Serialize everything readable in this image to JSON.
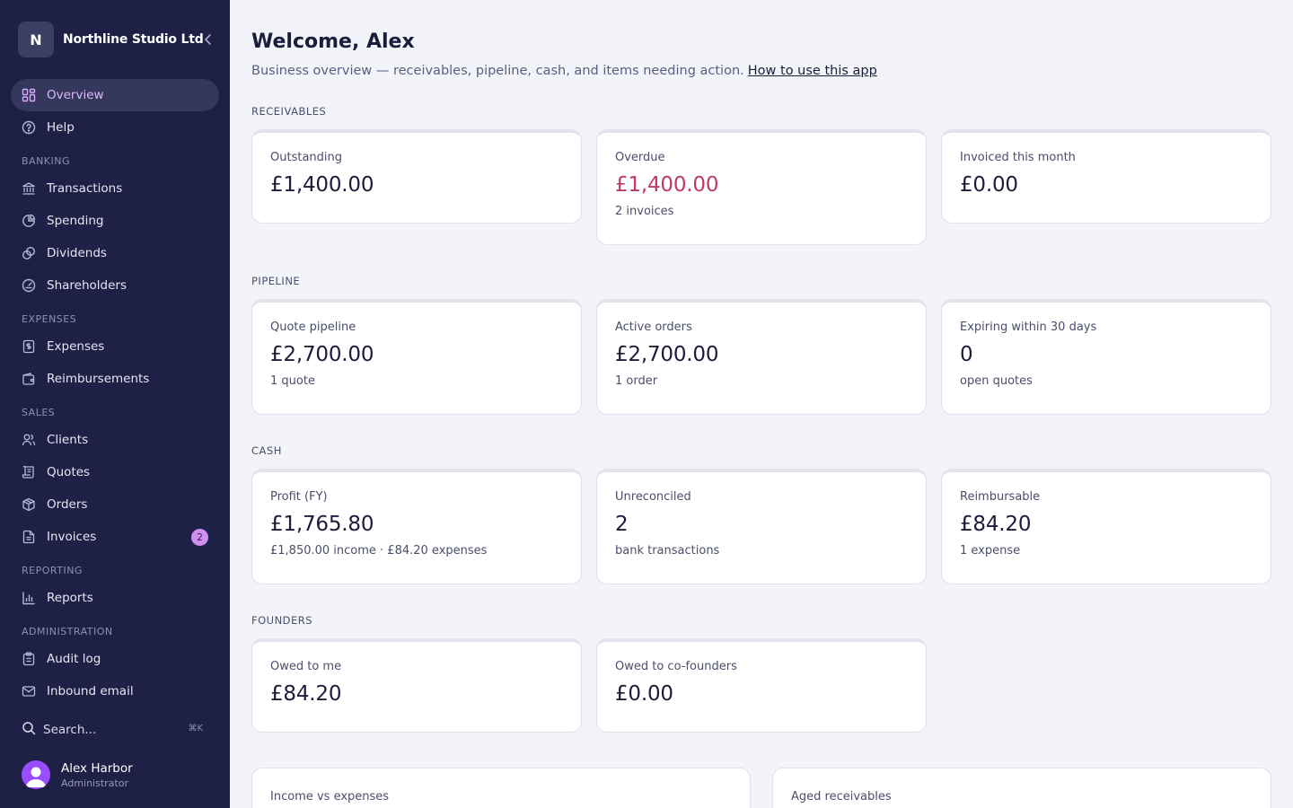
{
  "sidebar": {
    "brand": {
      "logo_letter": "N",
      "name": "Northline Studio Ltd"
    },
    "items": {
      "overview": "Overview",
      "help": "Help",
      "transactions": "Transactions",
      "spending": "Spending",
      "dividends": "Dividends",
      "shareholders": "Shareholders",
      "expenses": "Expenses",
      "reimbursements": "Reimbursements",
      "clients": "Clients",
      "quotes": "Quotes",
      "orders": "Orders",
      "invoices": "Invoices",
      "reports": "Reports",
      "audit_log": "Audit log",
      "inbound_email": "Inbound email"
    },
    "invoices_badge": "2",
    "sections": {
      "banking": "BANKING",
      "expenses": "EXPENSES",
      "sales": "SALES",
      "reporting": "REPORTING",
      "administration": "ADMINISTRATION"
    },
    "search": {
      "label": "Search...",
      "shortcut": "⌘K"
    },
    "user": {
      "name": "Alex Harbor",
      "role": "Administrator"
    },
    "active_item": "overview",
    "accent_color": "#d9a7ff"
  },
  "main": {
    "title": "Welcome, Alex",
    "subtitle": "Business overview — receivables, pipeline, cash, and items needing action.",
    "help_link": "How to use this app",
    "groups": {
      "receivables": "RECEIVABLES",
      "pipeline": "PIPELINE",
      "cash": "CASH",
      "founders": "FOUNDERS"
    },
    "cards": {
      "outstanding": {
        "label": "Outstanding",
        "value": "£1,400.00"
      },
      "overdue": {
        "label": "Overdue",
        "value": "£1,400.00",
        "sub": "2 invoices"
      },
      "invoiced_month": {
        "label": "Invoiced this month",
        "value": "£0.00"
      },
      "quote_pipeline": {
        "label": "Quote pipeline",
        "value": "£2,700.00",
        "sub": "1 quote"
      },
      "active_orders": {
        "label": "Active orders",
        "value": "£2,700.00",
        "sub": "1 order"
      },
      "expiring": {
        "label": "Expiring within 30 days",
        "value": "0",
        "sub": "open quotes"
      },
      "profit": {
        "label": "Profit (FY)",
        "value": "£1,765.80",
        "sub": "£1,850.00 income · £84.20 expenses"
      },
      "unreconciled": {
        "label": "Unreconciled",
        "value": "2",
        "sub": "bank transactions"
      },
      "reimbursable": {
        "label": "Reimbursable",
        "value": "£84.20",
        "sub": "1 expense"
      },
      "owed_to_me": {
        "label": "Owed to me",
        "value": "£84.20"
      },
      "owed_cofounders": {
        "label": "Owed to co-founders",
        "value": "£0.00"
      }
    },
    "panels": {
      "income_vs_expenses": "Income vs expenses",
      "aged_receivables": "Aged receivables"
    },
    "colors": {
      "danger": "#c13a61",
      "sidebar_bg": "#1e2145"
    }
  }
}
